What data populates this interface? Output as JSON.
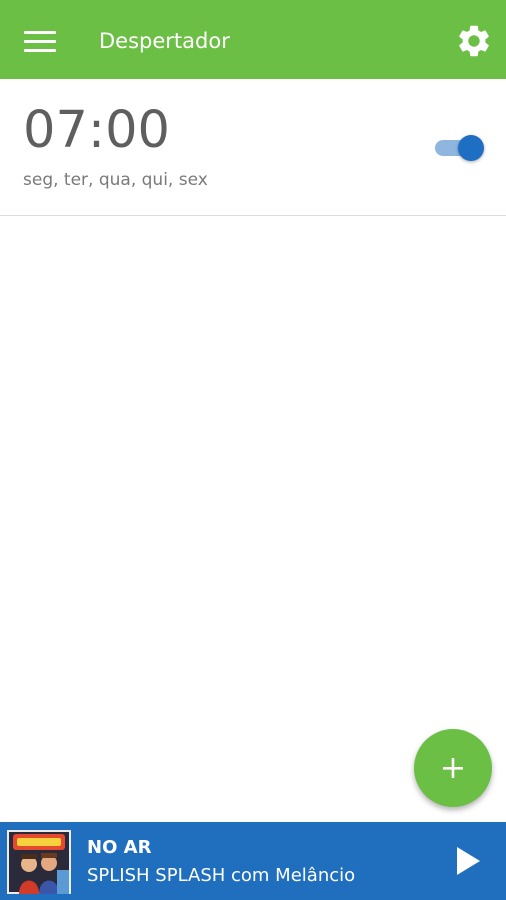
{
  "appbar": {
    "title": "Despertador",
    "menu_icon": "hamburger-menu-icon",
    "settings_icon": "gear-icon",
    "color": "#6cbf45"
  },
  "alarms": [
    {
      "time": "07:00",
      "days": "seg, ter, qua, qui, sex",
      "enabled": true
    }
  ],
  "toggle": {
    "track_color": "#8fb6de",
    "thumb_color": "#1e6fc3"
  },
  "fab": {
    "icon": "plus-icon",
    "color": "#6cbf45"
  },
  "player": {
    "status": "NO AR",
    "track": "SPLISH SPLASH com Melâncio",
    "play_icon": "play-icon",
    "cover_icon": "album-cover-image",
    "color": "#1f6fbe"
  }
}
